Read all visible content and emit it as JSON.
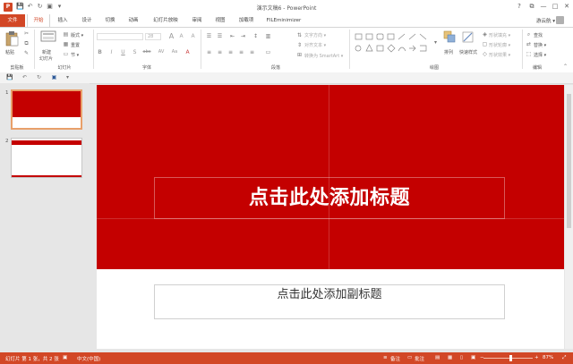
{
  "window": {
    "title": "演示文稿6 - PowerPoint",
    "logo_text": "P",
    "controls": [
      "?",
      "⧉",
      "—",
      "□",
      "✕"
    ]
  },
  "quick_access": {
    "save": "💾",
    "undo": "↶",
    "redo": "↻",
    "present": "▣",
    "more": "▾"
  },
  "tabs": [
    {
      "label": "文件"
    },
    {
      "label": "开始"
    },
    {
      "label": "插入"
    },
    {
      "label": "设计"
    },
    {
      "label": "切换"
    },
    {
      "label": "动画"
    },
    {
      "label": "幻灯片放映"
    },
    {
      "label": "审阅"
    },
    {
      "label": "视图"
    },
    {
      "label": "加载项"
    },
    {
      "label": "FILEminimizer"
    }
  ],
  "user": {
    "name": "游云航 ▾"
  },
  "ribbon": {
    "clipboard": {
      "paste": "粘贴",
      "group": "剪贴板"
    },
    "slides": {
      "new_slide": "新建",
      "new_slide_2": "幻灯片",
      "layout": "版式 ▾",
      "reset": "重置",
      "section": "节 ▾",
      "group": "幻灯片"
    },
    "font": {
      "size": "28",
      "group": "字体",
      "bold": "B",
      "italic": "I",
      "underline": "U",
      "shadow": "S",
      "strike": "abc",
      "spacing": "AV",
      "case": "Aa",
      "color": "A",
      "grow": "A",
      "shrink": "A",
      "clear": "A"
    },
    "paragraph": {
      "group": "段落",
      "text_direction": "文字方向 ▾",
      "align_text": "对齐文本 ▾",
      "smartart": "转换为 SmartArt ▾"
    },
    "drawing": {
      "group": "绘图",
      "arrange": "排列",
      "quick_styles": "快速样式",
      "fill": "形状填充 ▾",
      "outline": "形状轮廓 ▾",
      "effects": "形状效果 ▾"
    },
    "editing": {
      "group": "编辑",
      "find": "查找",
      "replace": "替换 ▾",
      "select": "选择 ▾"
    }
  },
  "thumbnails": [
    {
      "number": "1"
    },
    {
      "number": "2"
    }
  ],
  "slide": {
    "title": "点击此处添加标题",
    "subtitle": "点击此处添加副标题"
  },
  "status": {
    "slide_info": "幻灯片 第 1 张，共 2 张",
    "language": "中文(中国)",
    "notes": "备注",
    "comments": "批注",
    "zoom": "87%",
    "zoom_minus": "−",
    "zoom_plus": "+"
  },
  "colors": {
    "accent": "#d24726",
    "slide_red": "#c40000"
  }
}
